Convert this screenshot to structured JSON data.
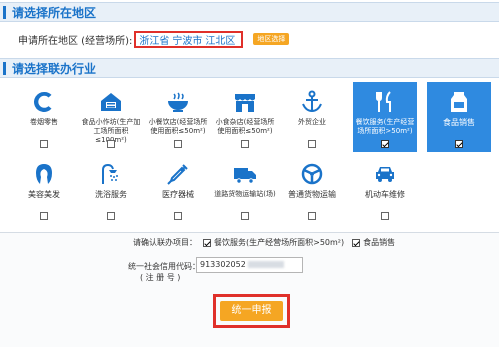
{
  "region_section": {
    "title": "请选择所在地区"
  },
  "region_row": {
    "label": "申请所在地区 (经营场所):",
    "province": "浙江省",
    "city": "宁波市",
    "district": "江北区",
    "select_button": "地区选择"
  },
  "industry_section": {
    "title": "请选择联办行业"
  },
  "industries_row1": [
    {
      "label": "卷烟零售",
      "icon": "cigarette-c-icon",
      "selected": false
    },
    {
      "label": "食品小作坊(生产加工场所面积≤100m²)",
      "icon": "factory-icon",
      "selected": false
    },
    {
      "label": "小餐饮店(经营场所使用面积≤50m²)",
      "icon": "bowl-icon",
      "selected": false
    },
    {
      "label": "小食杂店(经营场所使用面积≤50m²)",
      "icon": "shop-icon",
      "selected": false
    },
    {
      "label": "外贸企业",
      "icon": "anchor-icon",
      "selected": false
    },
    {
      "label": "餐饮服务(生产经营场所面积>50m²)",
      "icon": "fork-knife-icon",
      "selected": true
    },
    {
      "label": "食品销售",
      "icon": "milk-carton-icon",
      "selected": true
    }
  ],
  "industries_row2": [
    {
      "label": "美容美发",
      "icon": "hair-icon",
      "selected": false
    },
    {
      "label": "洗浴服务",
      "icon": "shower-icon",
      "selected": false
    },
    {
      "label": "医疗器械",
      "icon": "syringe-icon",
      "selected": false
    },
    {
      "label": "道路货物运输站(场)",
      "icon": "truck-icon",
      "selected": false
    },
    {
      "label": "普通货物运输",
      "icon": "steering-wheel-icon",
      "selected": false
    },
    {
      "label": "机动车维修",
      "icon": "car-repair-icon",
      "selected": false
    }
  ],
  "confirm": {
    "label": "请确认联办项目：",
    "item1": "餐饮服务(生产经营场所面积>50m²)",
    "item2": "食品销售",
    "credit_label": "统一社会信用代码：",
    "credit_sub": "( 注 册 号 )",
    "credit_value": "913302052"
  },
  "submit": {
    "label": "统一申报"
  },
  "colors": {
    "accent": "#1a73c9",
    "selected_tile": "#2f8ae0",
    "button": "#f5a623",
    "highlight": "#e0302a"
  }
}
